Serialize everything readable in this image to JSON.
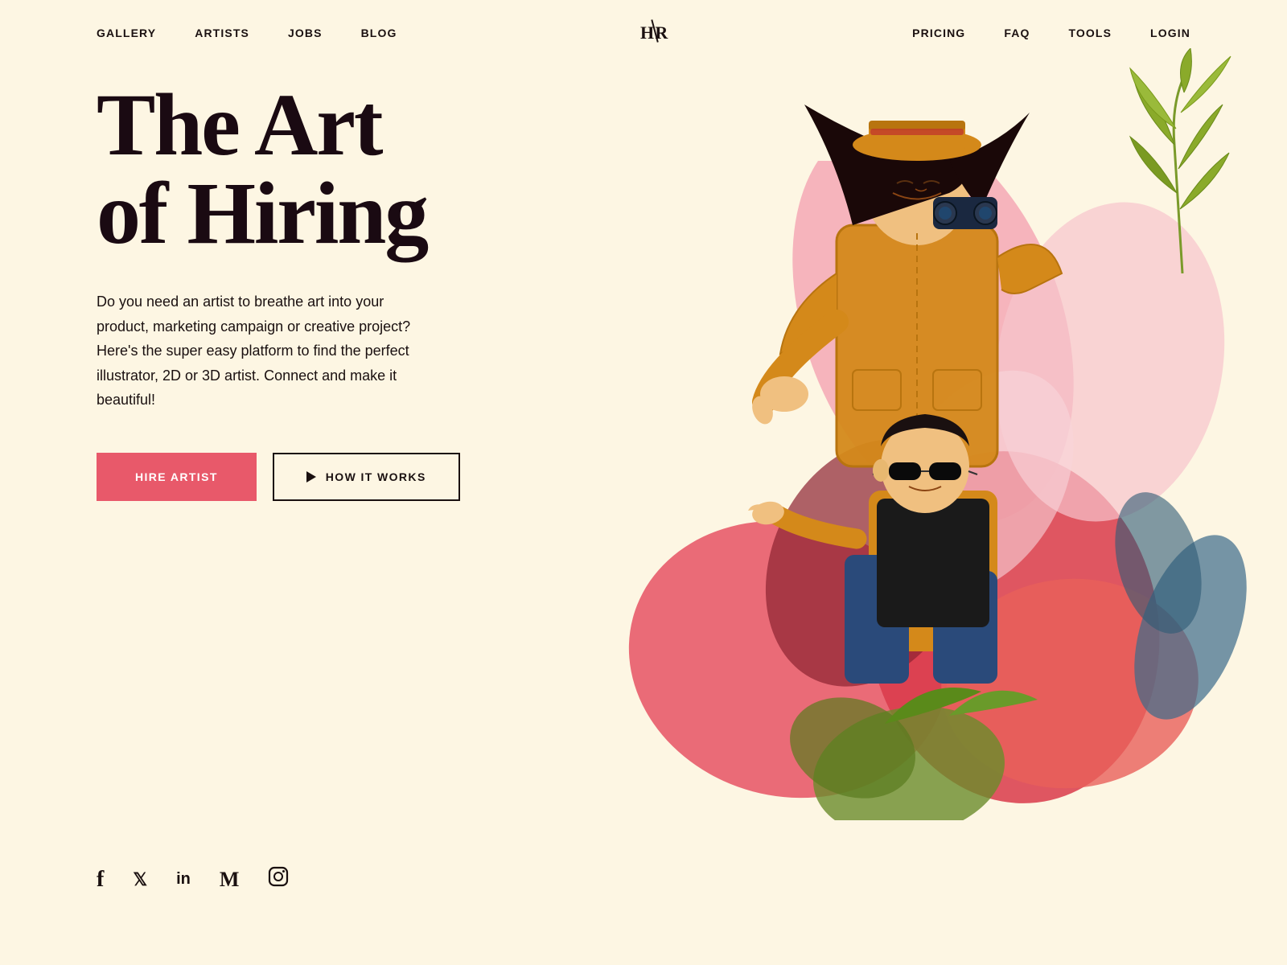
{
  "nav": {
    "left_links": [
      "GALLERY",
      "ARTISTS",
      "JOBS",
      "BLOG"
    ],
    "right_links": [
      "PRICING",
      "FAQ",
      "TOOLS",
      "LOGIN"
    ],
    "logo": "H/R"
  },
  "hero": {
    "title_line1": "The Art",
    "title_line2": "of Hiring",
    "subtitle": "Do you need an artist to breathe art into your product, marketing campaign or creative project? Here's the super easy platform to find the perfect illustrator, 2D or 3D artist. Connect and make it beautiful!",
    "cta_primary": "HIRE ARTIST",
    "cta_secondary": "HOW IT WORKS"
  },
  "social": {
    "icons": [
      "f",
      "𝕏",
      "in",
      "M",
      "⊙"
    ]
  },
  "colors": {
    "background": "#fdf6e3",
    "text_dark": "#1a0a12",
    "btn_red": "#e8596a",
    "btn_red_hover": "#d44a5b"
  }
}
